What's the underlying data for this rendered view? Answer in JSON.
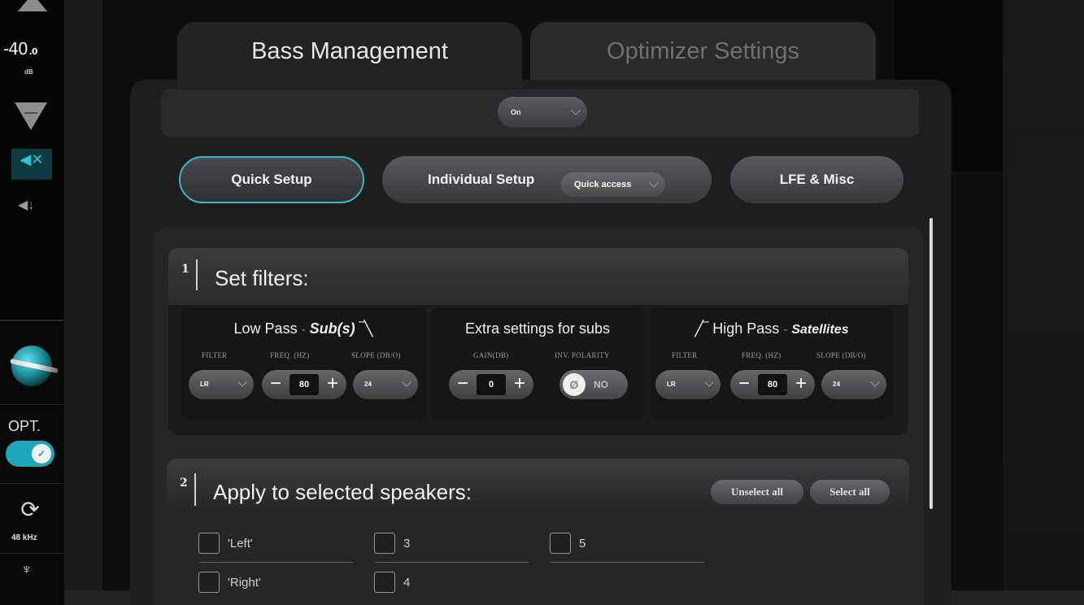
{
  "sidebar": {
    "volume_value": "-40",
    "volume_decimal": ".0",
    "volume_unit": "dB",
    "opt_label": "OPT.",
    "sample_rate": "48 kHz"
  },
  "tabs": [
    {
      "label": "Bass Management"
    },
    {
      "label": "Optimizer Settings"
    }
  ],
  "onoff": {
    "value": "On"
  },
  "modes": {
    "quick": "Quick Setup",
    "individual": "Individual Setup",
    "quick_access": "Quick access",
    "lfe": "LFE & Misc"
  },
  "section1": {
    "number": "1",
    "title": "Set filters:",
    "low_pass": {
      "title": "Low Pass",
      "sep": "-",
      "target": "Sub(s)",
      "filter_label": "FILTER",
      "freq_label": "FREQ. (hz)",
      "slope_label": "SLOPE (dB/o)",
      "filter_value": "LR",
      "freq_value": "80",
      "slope_value": "24"
    },
    "extra": {
      "title": "Extra settings for subs",
      "gain_label": "GAIN(dB)",
      "polarity_label": "INV. POLARITY",
      "gain_value": "0",
      "polarity_value": "NO"
    },
    "high_pass": {
      "title": "High Pass",
      "sep": "-",
      "target": "Satellites",
      "filter_label": "FILTER",
      "freq_label": "FREQ. (hz)",
      "slope_label": "SLOPE (dB/o)",
      "filter_value": "LR",
      "freq_value": "80",
      "slope_value": "24"
    }
  },
  "section2": {
    "number": "2",
    "title": "Apply to selected speakers:",
    "unselect_all": "Unselect all",
    "select_all": "Select all",
    "speakers": [
      "'Left'",
      "3",
      "5",
      "'Right'",
      "4"
    ]
  },
  "colors": {
    "accent": "#1fa7b7",
    "panel": "#1e1e20"
  }
}
